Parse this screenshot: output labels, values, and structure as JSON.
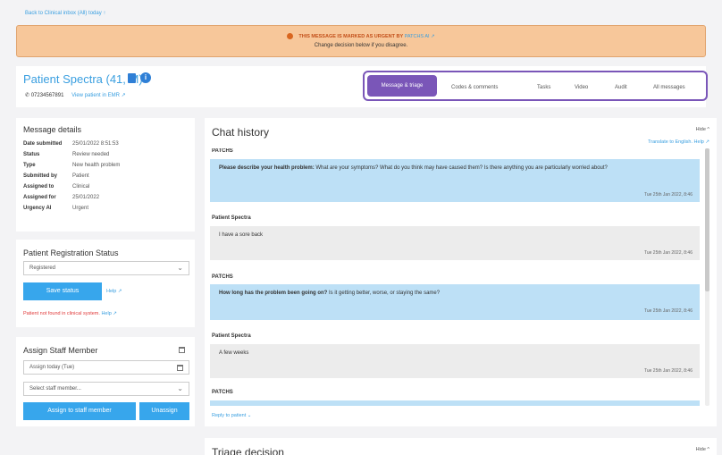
{
  "nav": {
    "back_link": "Back to Clinical inbox (All) today ↑"
  },
  "alert": {
    "urgent_text": "THIS MESSAGE IS MARKED AS URGENT BY",
    "flag_source": "PATCHS AI ↗",
    "decision_text": "Change decision below if you disagree."
  },
  "patient": {
    "name": "Patient Spectra (41, M)",
    "phone": "07234567891",
    "view_link": "View patient in EMR ↗"
  },
  "tabs": [
    "Message & triage",
    "Codes & comments",
    "Tasks",
    "Video",
    "Audit",
    "All messages"
  ],
  "message_details": {
    "title": "Message details",
    "rows": [
      {
        "key": "Date submitted",
        "value": "25/01/2022 8:51:53"
      },
      {
        "key": "Status",
        "value": "Review needed"
      },
      {
        "key": "Type",
        "value": "New health problem"
      },
      {
        "key": "Submitted by",
        "value": "Patient"
      },
      {
        "key": "Assigned to",
        "value": "Clinical"
      },
      {
        "key": "Assigned for",
        "value": "25/01/2022"
      },
      {
        "key": "Urgency AI",
        "value": "Urgent"
      }
    ]
  },
  "registration": {
    "title": "Patient Registration Status",
    "selected": "Registered",
    "save_label": "Save status",
    "help_label": "Help ↗",
    "error_text": "Patient not found in clinical system.",
    "error_help": "Help ↗"
  },
  "assign": {
    "title": "Assign Staff Member",
    "date_value": "Assign today (Tue)",
    "staff_placeholder": "Select staff member...",
    "assign_label": "Assign to staff member",
    "unassign_label": "Unassign"
  },
  "chat": {
    "title": "Chat history",
    "hide_label": "Hide ^",
    "translate_label": "Translate to English. Help ↗",
    "reply_label": "Reply to patient ⌄",
    "messages": [
      {
        "sender": "PATCHS",
        "bold": "Please describe your health problem:",
        "text": " What are your symptoms? What do you think may have caused them? Is there anything you are particularly worried about?",
        "time": "Tue 25th Jan 2022, 8:46"
      },
      {
        "sender": "Patient Spectra",
        "bold": "",
        "text": "I have a sore back",
        "time": "Tue 25th Jan 2022, 8:46"
      },
      {
        "sender": "PATCHS",
        "bold": "How long has the problem been going on?",
        "text": " Is it getting better, worse, or staying the same?",
        "time": "Tue 25th Jan 2022, 8:46"
      },
      {
        "sender": "Patient Spectra",
        "bold": "",
        "text": "A few weeks",
        "time": "Tue 25th Jan 2022, 8:46"
      },
      {
        "sender": "PATCHS",
        "bold": "",
        "text": "",
        "time": ""
      }
    ]
  },
  "triage": {
    "title": "Triage decision",
    "hide_label": "Hide ^"
  },
  "colors": {
    "accent": "#3a9fe0",
    "tab_active": "#7a56b8",
    "alert_bg": "#f7c79a",
    "patches_bubble": "#bde0f6",
    "patient_bubble": "#ececec",
    "error": "#e03a3a"
  }
}
